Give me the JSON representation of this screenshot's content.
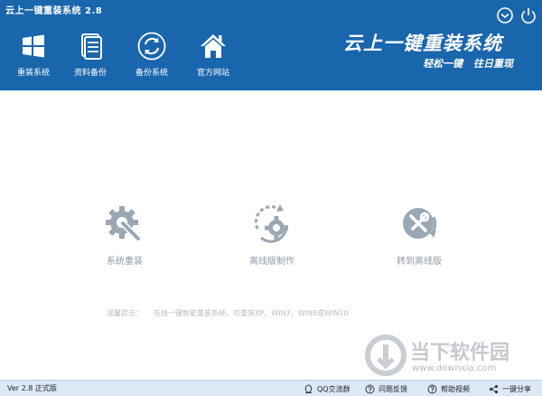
{
  "window": {
    "title": "云上一键重装系统 2.8",
    "buttons": [
      {
        "icon": "menu-icon"
      },
      {
        "icon": "power-icon"
      }
    ]
  },
  "nav": {
    "items": [
      {
        "label": "重装系统",
        "icon": "windows-logo-icon"
      },
      {
        "label": "资料备份",
        "icon": "document-stack-icon"
      },
      {
        "label": "备份系统",
        "icon": "refresh-circle-icon"
      },
      {
        "label": "官方网站",
        "icon": "house-icon"
      }
    ]
  },
  "brand": {
    "title": "云上一键重装系统",
    "slogan": "轻松一键 往日重现"
  },
  "features": [
    {
      "label": "系统重装",
      "icon": "gear-wrench-icon"
    },
    {
      "label": "离线版制作",
      "icon": "cycle-gear-icon"
    },
    {
      "label": "转到离线版",
      "icon": "tools-circle-icon"
    }
  ],
  "tip": {
    "label": "温馨提示：",
    "text": "在线一键智能重装系统，可重装XP、WIN7、WIN8或WIN10"
  },
  "footer": {
    "version": "Ver 2.8 正式版",
    "links": [
      {
        "label": "QQ交流群",
        "icon": "qq-icon"
      },
      {
        "label": "问题反馈",
        "icon": "help-circle-icon"
      },
      {
        "label": "帮助视频",
        "icon": "question-circle-icon"
      },
      {
        "label": "一键分享",
        "icon": "share-icon"
      }
    ]
  },
  "watermark": {
    "name": "当下软件园",
    "url": "www.downxia.com"
  },
  "colors": {
    "header": "#1a66ad",
    "footer": "#dce9f5",
    "feature_icon": "#9aa7b4"
  }
}
